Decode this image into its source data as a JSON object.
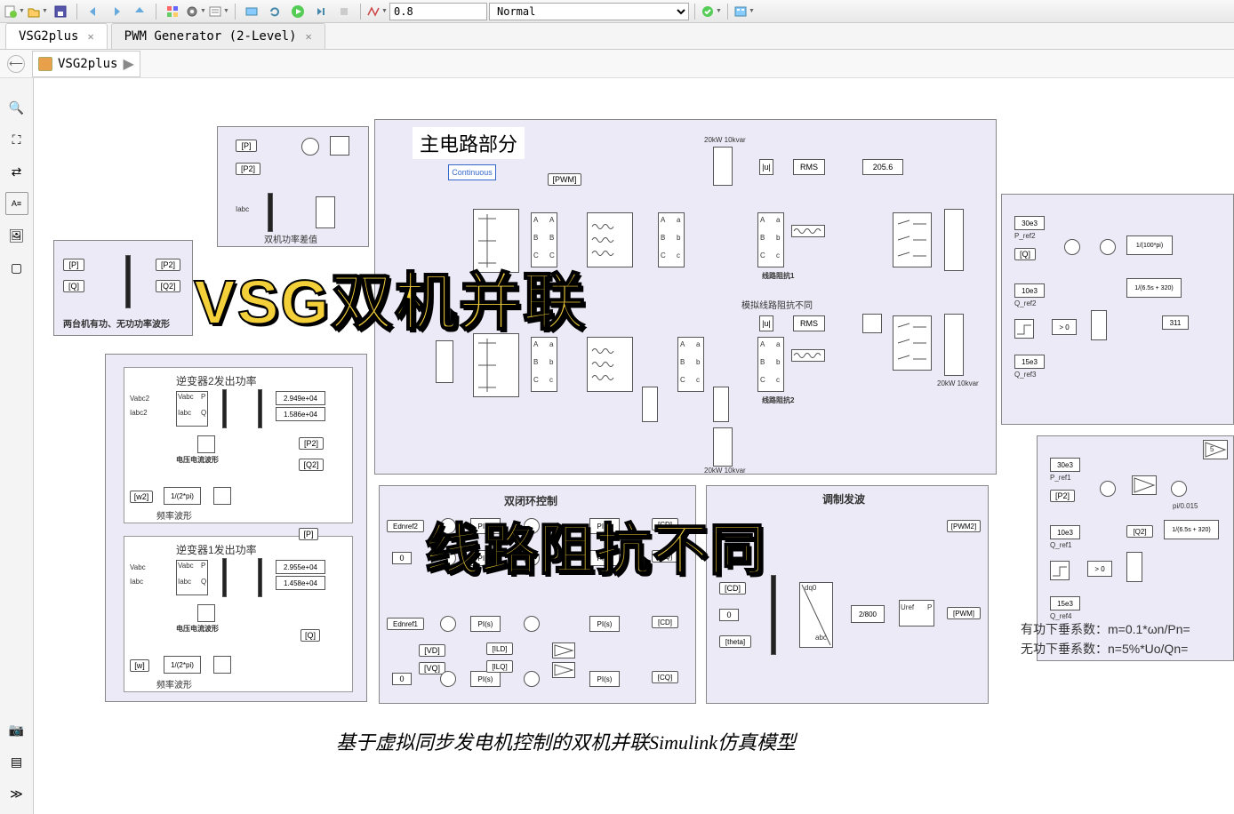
{
  "toolbar": {
    "step_value": "0.8",
    "mode": "Normal"
  },
  "tabs": [
    {
      "label": "VSG2plus",
      "active": true
    },
    {
      "label": "PWM Generator (2-Level)",
      "active": false
    }
  ],
  "breadcrumb": {
    "model": "VSG2plus"
  },
  "canvas": {
    "main_title": "主电路部分",
    "continuous": "Continuous",
    "pwm_tag": "[PWM]",
    "load_top": "20kW 10kvar",
    "load_bottom": "20kW 10kvar",
    "rms": "RMS",
    "rms_value": "205.6",
    "line_z1": "线路阻抗1",
    "line_z2": "线路阻抗2",
    "sim_line": "模拟线路阻抗不同",
    "scopes_box": {
      "tag_p": "[P]",
      "tag_q": "[Q]",
      "tag_p2": "[P2]",
      "tag_q2": "[Q2]",
      "caption": "两台机有功、无功功率波形"
    },
    "diff_box": {
      "tag_p": "[P]",
      "tag_p2": "[P2]",
      "iabc": "Iabc",
      "caption": "双机功率差值"
    },
    "inv2": {
      "title": "逆变器2发出功率",
      "vabc": "Vabc2",
      "iabc": "Iabc2",
      "v_in": "Vabc",
      "i_in": "Iabc",
      "p_out": "P",
      "q_out": "Q",
      "gain": "1/(2*pi)",
      "val1": "2.949e+04",
      "val2": "1.586e+04",
      "tag_p2": "[P2]",
      "tag_q2": "[Q2]",
      "w2": "[w2]",
      "wave": "电压电流波形",
      "freq": "频率波形"
    },
    "inv1": {
      "title": "逆变器1发出功率",
      "vabc": "Vabc",
      "iabc": "Iabc",
      "v_in": "Vabc",
      "i_in": "Iabc",
      "p_out": "P",
      "q_out": "Q",
      "gain": "1/(2*pi)",
      "val1": "2.955e+04",
      "val2": "1.458e+04",
      "tag_p": "[P]",
      "tag_q": "[Q]",
      "w": "[w]",
      "wave": "电压电流波形",
      "freq": "频率波形"
    },
    "dloop": {
      "title": "双闭环控制",
      "ednref2": "Ednref2",
      "ednref1": "Ednref1",
      "zero": "0",
      "ivd": "[VD]",
      "ivq": "[VQ]",
      "pi": "PI(s)",
      "ild": "[ILD]",
      "ilq": "[ILQ]",
      "icd": "[CD]",
      "icq": "[CQ]"
    },
    "mod": {
      "title": "调制发波",
      "cd": "[CD]",
      "zero": "0",
      "theta": "[theta]",
      "dq0": "dq0",
      "abc": "abc",
      "gain": "2/800",
      "uref": "Uref",
      "p": "P",
      "pwm": "[PWM]"
    },
    "right_top": {
      "val1": "30e3",
      "p_ref2": "P_ref2",
      "q": "[Q]",
      "val2": "10e3",
      "q_ref2": "Q_ref2",
      "val3": "15e3",
      "q_ref3": "Q_ref3",
      "gain1": "1/(100*pi)",
      "tf": "1/(6.5s + 320)",
      "const311": "311",
      "cmp": "> 0"
    },
    "right_bot": {
      "val1": "30e3",
      "p_ref1": "P_ref1",
      "p2": "[P2]",
      "val2": "10e3",
      "q2": "[Q2]",
      "q_ref1": "Q_ref1",
      "val3": "15e3",
      "q_ref4": "Q_ref4",
      "tf": "1/(6.5s + 320)",
      "gain": "pi/0.015",
      "cmp": "> 0",
      "const5": "5"
    },
    "notes": {
      "line1": "有功下垂系数：m=0.1*ωn/Pn=",
      "line2": "无功下垂系数：n=5%*Uo/Qn="
    },
    "caption_bottom": "基于虚拟同步发电机控制的双机并联Simulink仿真模型"
  },
  "headlines": {
    "h1": "VSG双机并联",
    "h2": "线路阻抗不同"
  }
}
